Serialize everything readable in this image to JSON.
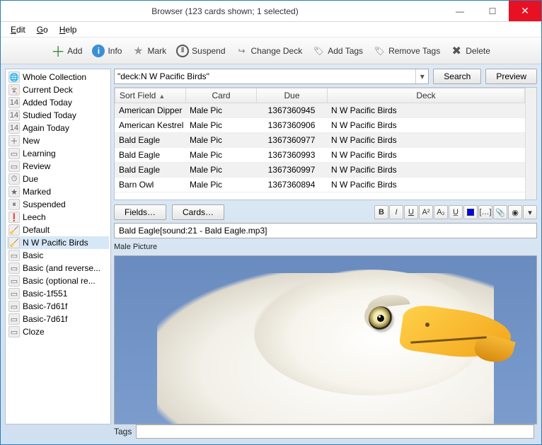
{
  "window": {
    "title": "Browser (123 cards shown; 1 selected)"
  },
  "menu": {
    "edit": "Edit",
    "go": "Go",
    "help": "Help"
  },
  "toolbar": {
    "add": "Add",
    "info": "Info",
    "mark": "Mark",
    "suspend": "Suspend",
    "change_deck": "Change Deck",
    "add_tags": "Add Tags",
    "remove_tags": "Remove Tags",
    "delete": "Delete"
  },
  "sidebar": {
    "items": [
      {
        "label": "Whole Collection",
        "icon": "🌐"
      },
      {
        "label": "Current Deck",
        "icon": "🃏"
      },
      {
        "label": "Added Today",
        "icon": "14"
      },
      {
        "label": "Studied Today",
        "icon": "14"
      },
      {
        "label": "Again Today",
        "icon": "14"
      },
      {
        "label": "New",
        "icon": "＋"
      },
      {
        "label": "Learning",
        "icon": "▭"
      },
      {
        "label": "Review",
        "icon": "▭"
      },
      {
        "label": "Due",
        "icon": "⏱"
      },
      {
        "label": "Marked",
        "icon": "★"
      },
      {
        "label": "Suspended",
        "icon": "⏸"
      },
      {
        "label": "Leech",
        "icon": "❗"
      },
      {
        "label": "Default",
        "icon": "🧹"
      },
      {
        "label": "N W Pacific Birds",
        "icon": "🧹",
        "selected": true
      },
      {
        "label": "Basic",
        "icon": "▭"
      },
      {
        "label": "Basic (and reverse...",
        "icon": "▭"
      },
      {
        "label": "Basic (optional re...",
        "icon": "▭"
      },
      {
        "label": "Basic-1f551",
        "icon": "▭"
      },
      {
        "label": "Basic-7d61f",
        "icon": "▭"
      },
      {
        "label": "Basic-7d61f",
        "icon": "▭"
      },
      {
        "label": "Cloze",
        "icon": "▭"
      }
    ]
  },
  "search": {
    "query": "\"deck:N W Pacific Birds\"",
    "search_btn": "Search",
    "preview_btn": "Preview"
  },
  "table": {
    "cols": {
      "sort_field": "Sort Field",
      "card": "Card",
      "due": "Due",
      "deck": "Deck"
    },
    "rows": [
      {
        "sf": "American Dipper",
        "card": "Male Pic",
        "due": "1367360945",
        "deck": "N W Pacific Birds"
      },
      {
        "sf": "American Kestrel",
        "card": "Male Pic",
        "due": "1367360906",
        "deck": "N W Pacific Birds"
      },
      {
        "sf": "Bald Eagle",
        "card": "Male Pic",
        "due": "1367360977",
        "deck": "N W Pacific Birds"
      },
      {
        "sf": "Bald Eagle",
        "card": "Male Pic",
        "due": "1367360993",
        "deck": "N W Pacific Birds"
      },
      {
        "sf": "Bald Eagle",
        "card": "Male Pic",
        "due": "1367360997",
        "deck": "N W Pacific Birds"
      },
      {
        "sf": "Barn Owl",
        "card": "Male Pic",
        "due": "1367360894",
        "deck": "N W Pacific Birds"
      }
    ]
  },
  "editor": {
    "fields_btn": "Fields…",
    "cards_btn": "Cards…",
    "field1_value": "Bald Eagle[sound:21 - Bald Eagle.mp3]",
    "field2_label": "Male Picture",
    "fmt": {
      "b": "B",
      "i": "I",
      "u": "U",
      "sup": "A²",
      "sub": "A₂",
      "strike": "U̲",
      "clr": "",
      "brackets": "[…]",
      "clip": "📎",
      "rec": "◉",
      "dd": "▾"
    }
  },
  "status": {
    "tags_label": "Tags",
    "tags_value": ""
  }
}
